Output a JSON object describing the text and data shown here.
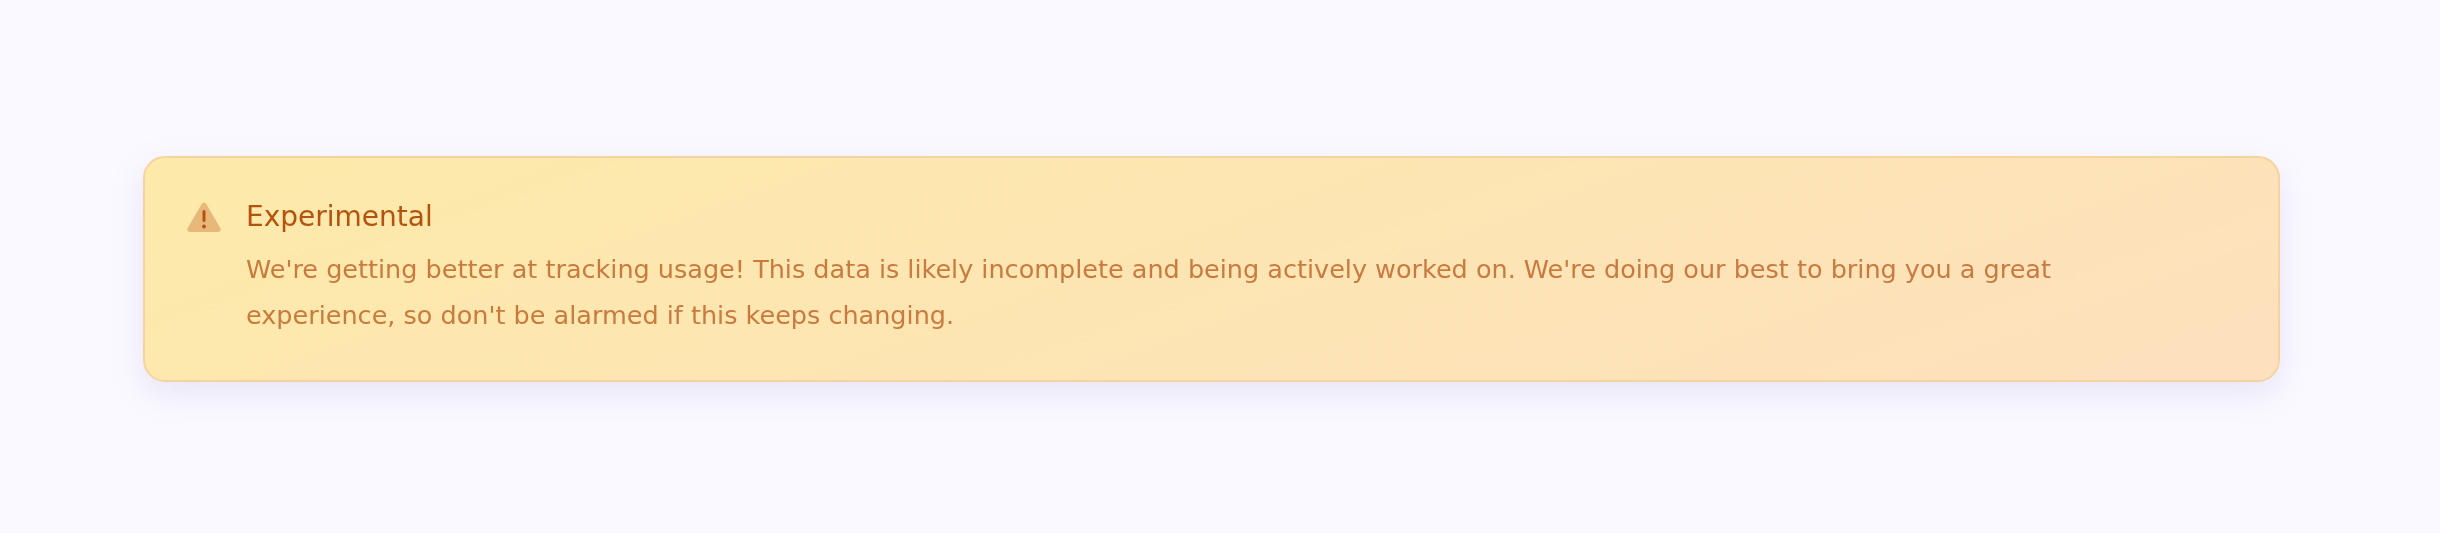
{
  "alert": {
    "kind": "warning",
    "title": "Experimental",
    "message": "We're getting better at tracking usage! This data is likely incomplete and being actively worked on. We're doing our best to bring you a great experience, so don't be alarmed if this keeps changing."
  }
}
